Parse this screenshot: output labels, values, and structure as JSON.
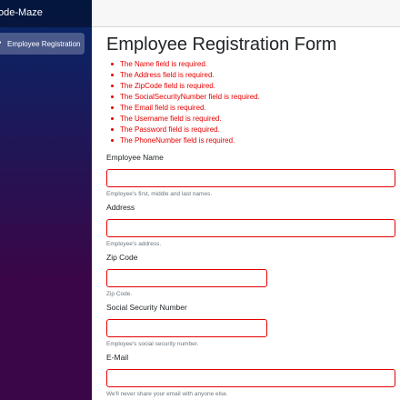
{
  "app": {
    "brand": "ode-Maze"
  },
  "sidebar": {
    "items": [
      {
        "label": "Employee Registration",
        "icon": "people-icon"
      }
    ]
  },
  "form": {
    "title": "Employee Registration Form",
    "errors": [
      "The Name field is required.",
      "The Address field is required.",
      "The ZipCode field is required.",
      "The SocialSecurityNumber field is required.",
      "The Email field is required.",
      "The Username field is required.",
      "The Password field is required.",
      "The PhoneNumber field is required."
    ],
    "fields": {
      "name": {
        "label": "Employee Name",
        "value": "",
        "help": "Employee's first, middle and last names."
      },
      "address": {
        "label": "Address",
        "value": "",
        "help": "Employee's address."
      },
      "zip": {
        "label": "Zip Code",
        "value": "",
        "help": "Zip Code."
      },
      "ssn": {
        "label": "Social Security Number",
        "value": "",
        "help": "Employee's social security number."
      },
      "email": {
        "label": "E-Mail",
        "value": "",
        "help": "We'll never share your email with anyone else."
      }
    }
  },
  "colors": {
    "error": "#e50000",
    "sidebar_top": "#052767",
    "sidebar_bottom": "#3a0647"
  }
}
